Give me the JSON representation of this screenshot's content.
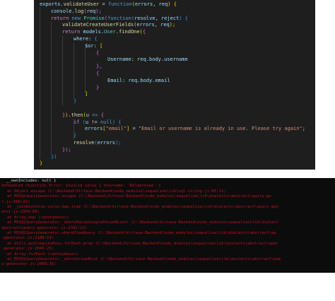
{
  "editor": {
    "lines": [
      {
        "indent": 0,
        "segments": [
          {
            "t": "exports",
            "c": "var"
          },
          {
            "t": ".",
            "c": "pun"
          },
          {
            "t": "validateUser",
            "c": "fn"
          },
          {
            "t": " = ",
            "c": "pun"
          },
          {
            "t": "function",
            "c": "kw"
          },
          {
            "t": "(",
            "c": "br1"
          },
          {
            "t": "errors",
            "c": "var"
          },
          {
            "t": ", ",
            "c": "pun"
          },
          {
            "t": "req",
            "c": "var"
          },
          {
            "t": ") ",
            "c": "br1"
          },
          {
            "t": "{",
            "c": "br1"
          }
        ]
      },
      {
        "indent": 1,
        "segments": [
          {
            "t": "console",
            "c": "var"
          },
          {
            "t": ".",
            "c": "pun"
          },
          {
            "t": "log",
            "c": "fn"
          },
          {
            "t": "(",
            "c": "br2"
          },
          {
            "t": "req",
            "c": "var"
          },
          {
            "t": ");",
            "c": "br2"
          }
        ]
      },
      {
        "indent": 1,
        "segments": [
          {
            "t": "return ",
            "c": "kw2"
          },
          {
            "t": "new ",
            "c": "kw"
          },
          {
            "t": "Promise",
            "c": "cls"
          },
          {
            "t": "(",
            "c": "br2"
          },
          {
            "t": "function",
            "c": "kw"
          },
          {
            "t": "(",
            "c": "br3"
          },
          {
            "t": "resolve",
            "c": "var"
          },
          {
            "t": ", ",
            "c": "pun"
          },
          {
            "t": "reject",
            "c": "var"
          },
          {
            "t": ") ",
            "c": "br3"
          },
          {
            "t": "{",
            "c": "br3"
          }
        ]
      },
      {
        "indent": 2,
        "segments": [
          {
            "t": "validateCreateUserFields",
            "c": "fn"
          },
          {
            "t": "(",
            "c": "br1"
          },
          {
            "t": "errors",
            "c": "var"
          },
          {
            "t": ", ",
            "c": "pun"
          },
          {
            "t": "req",
            "c": "var"
          },
          {
            "t": ");",
            "c": "br1"
          }
        ]
      },
      {
        "indent": 2,
        "segments": [
          {
            "t": "return ",
            "c": "kw2"
          },
          {
            "t": "models",
            "c": "var"
          },
          {
            "t": ".",
            "c": "pun"
          },
          {
            "t": "User",
            "c": "cls"
          },
          {
            "t": ".",
            "c": "pun"
          },
          {
            "t": "findOne",
            "c": "fn"
          },
          {
            "t": "(",
            "c": "br1"
          },
          {
            "t": "{",
            "c": "br2"
          }
        ]
      },
      {
        "indent": 3,
        "segments": [
          {
            "t": "where",
            "c": "var"
          },
          {
            "t": ": ",
            "c": "pun"
          },
          {
            "t": "{",
            "c": "br3"
          }
        ]
      },
      {
        "indent": 4,
        "segments": [
          {
            "t": "$or",
            "c": "var"
          },
          {
            "t": ": ",
            "c": "pun"
          },
          {
            "t": "[",
            "c": "br1"
          }
        ]
      },
      {
        "indent": 5,
        "segments": [
          {
            "t": "{",
            "c": "br2"
          }
        ]
      },
      {
        "indent": 6,
        "segments": [
          {
            "t": "Username",
            "c": "var"
          },
          {
            "t": ": ",
            "c": "pun"
          },
          {
            "t": "req",
            "c": "var"
          },
          {
            "t": ".",
            "c": "pun"
          },
          {
            "t": "body",
            "c": "var"
          },
          {
            "t": ".",
            "c": "pun"
          },
          {
            "t": "username",
            "c": "var"
          }
        ]
      },
      {
        "indent": 5,
        "segments": [
          {
            "t": "},",
            "c": "br2"
          }
        ]
      },
      {
        "indent": 5,
        "segments": [
          {
            "t": "{",
            "c": "br2"
          }
        ]
      },
      {
        "indent": 6,
        "segments": [
          {
            "t": "Email",
            "c": "var"
          },
          {
            "t": ": ",
            "c": "pun"
          },
          {
            "t": "req",
            "c": "var"
          },
          {
            "t": ".",
            "c": "pun"
          },
          {
            "t": "body",
            "c": "var"
          },
          {
            "t": ".",
            "c": "pun"
          },
          {
            "t": "email",
            "c": "var"
          }
        ]
      },
      {
        "indent": 5,
        "segments": [
          {
            "t": "}",
            "c": "br2"
          }
        ]
      },
      {
        "indent": 4,
        "segments": [
          {
            "t": "]",
            "c": "br1"
          }
        ]
      },
      {
        "indent": 3,
        "segments": [
          {
            "t": "}",
            "c": "br3"
          }
        ]
      },
      {
        "indent": 0,
        "segments": []
      },
      {
        "indent": 2,
        "segments": [
          {
            "t": "}",
            "c": "br2"
          },
          {
            "t": ")",
            "c": "br1"
          },
          {
            "t": ".",
            "c": "pun"
          },
          {
            "t": "then",
            "c": "fn"
          },
          {
            "t": "(",
            "c": "br1"
          },
          {
            "t": "u",
            "c": "var"
          },
          {
            "t": " => ",
            "c": "kw"
          },
          {
            "t": "{",
            "c": "br2"
          }
        ]
      },
      {
        "indent": 3,
        "segments": [
          {
            "t": "if ",
            "c": "kw2"
          },
          {
            "t": "(",
            "c": "br3"
          },
          {
            "t": "u",
            "c": "var"
          },
          {
            "t": " != ",
            "c": "pun"
          },
          {
            "t": "null",
            "c": "kw"
          },
          {
            "t": ") ",
            "c": "br3"
          },
          {
            "t": "{",
            "c": "br3"
          }
        ]
      },
      {
        "indent": 4,
        "segments": [
          {
            "t": "errors",
            "c": "var"
          },
          {
            "t": "[",
            "c": "br1"
          },
          {
            "t": "\"email\"",
            "c": "str"
          },
          {
            "t": "]",
            "c": "br1"
          },
          {
            "t": " = ",
            "c": "pun"
          },
          {
            "t": "\"Email or username is already in use. Please try again\"",
            "c": "str"
          },
          {
            "t": ";",
            "c": "pun"
          }
        ]
      },
      {
        "indent": 3,
        "segments": [
          {
            "t": "}",
            "c": "br3"
          }
        ]
      },
      {
        "indent": 3,
        "segments": [
          {
            "t": "resolve",
            "c": "fn"
          },
          {
            "t": "(",
            "c": "br3"
          },
          {
            "t": "errors",
            "c": "var"
          },
          {
            "t": ");",
            "c": "br3"
          }
        ]
      },
      {
        "indent": 2,
        "segments": [
          {
            "t": "});",
            "c": "br2"
          }
        ]
      },
      {
        "indent": 1,
        "segments": [
          {
            "t": "})",
            "c": "br3"
          }
        ]
      },
      {
        "indent": 0,
        "segments": [
          {
            "t": "}",
            "c": "br1"
          }
        ]
      }
    ]
  },
  "terminal": {
    "lines": [
      {
        "indent": 0,
        "text": "  __ownIncludes: null }"
      },
      {
        "indent": 0,
        "text": "Unhandled rejection Error: Invalid value { Username: 'Rolderhowe' }"
      },
      {
        "indent": 1,
        "text": "at Object.escape (C:\\Backend\\Virtaxe-Backend\\node_modules\\sequelize\\lib\\sql-string.js:65:11)"
      },
      {
        "indent": 1,
        "text": "at MSSQLQueryGenerator.escape (C:\\Backend\\Virtaxe-Backend\\node_modules\\sequelize\\lib\\dialects\\abstract\\query-ge"
      },
      {
        "indent": 0,
        "text": "r.js:988:22)"
      },
      {
        "indent": 1,
        "text": "at _joinKeyValue.value.map.item (C:\\Backend\\Virtaxe-Backend\\node_modules\\sequelize\\lib\\dialects\\abstract\\query-gen"
      },
      {
        "indent": 0,
        "text": "ator.js:2304:89)"
      },
      {
        "indent": 1,
        "text": "at Array.map (<anonymous>)"
      },
      {
        "indent": 1,
        "text": "at MSSQLQueryGenerator._whereParseSingleValueObject (C:\\Backend\\Virtaxe-Backend\\node_modules\\sequelize\\lib\\dialect"
      },
      {
        "indent": 0,
        "text": "abstract\\query-generator.js:2302:12)"
      },
      {
        "indent": 1,
        "text": "at MSSQLQueryGenerator.whereItemQuery (C:\\Backend\\Virtaxe-Backend\\node_modules\\sequelize\\lib\\dialects\\abstract\\qu"
      },
      {
        "indent": 0,
        "text": "-generator.js:2180:19)"
      },
      {
        "indent": 1,
        "text": "at Utils.getComplexKeys.forEach.prop (C:\\Backend\\Virtaxe-Backend\\node_modules\\sequelize\\lib\\dialects\\abstract\\quer"
      },
      {
        "indent": 0,
        "text": "-generator.js:2046:25)"
      },
      {
        "indent": 1,
        "text": "at Array.forEach (<anonymous>)"
      },
      {
        "indent": 1,
        "text": "at MSSQLQueryGenerator._whereGroupBind (C:\\Backend\\Virtaxe-Backend\\node_modules\\sequelize\\lib\\dialects\\abstract\\que"
      },
      {
        "indent": 0,
        "text": "y-generator.js:2068:35)"
      }
    ]
  }
}
